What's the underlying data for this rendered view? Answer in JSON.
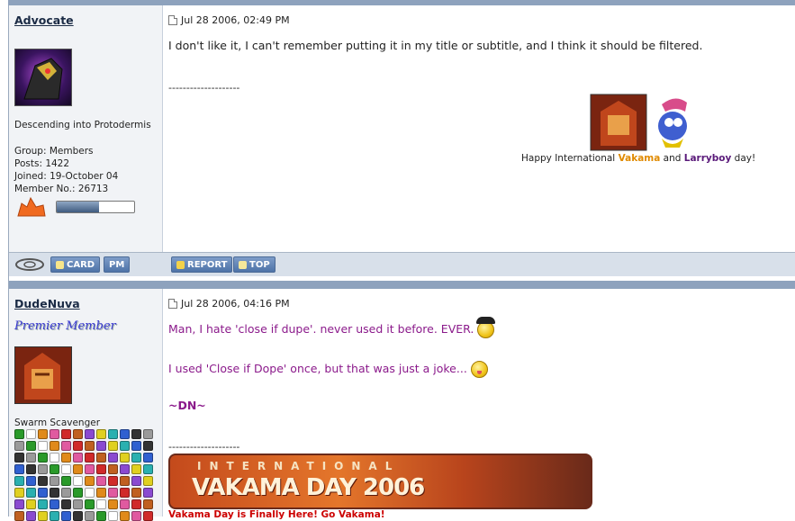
{
  "post1": {
    "author": "Advocate",
    "date": "Jul 28 2006, 02:49 PM",
    "title": "Descending into Protodermis",
    "group": "Group: Members",
    "posts": "Posts: 1422",
    "joined": "Joined: 19-October 04",
    "member_no": "Member No.: 26713",
    "rank_fill": 0.55,
    "message": "I don't like it, I can't remember putting it in my title or subtitle, and I think it should be filtered.",
    "sig_sep": "--------------------",
    "sig_text_pre": "Happy International ",
    "sig_vakama": "Vakama",
    "sig_and": " and ",
    "sig_larryboy": "Larryboy",
    "sig_post": " day!",
    "buttons": {
      "card": "CARD",
      "pm": "PM",
      "report": "REPORT",
      "top": "TOP"
    }
  },
  "post2": {
    "author": "DudeNuva",
    "date": "Jul 28 2006, 04:16 PM",
    "rank_title": "Premier Member",
    "title": "Swarm Scavenger",
    "line1": "Man, I hate 'close if dupe'. never used it before. EVER.",
    "line2": "I used 'Close if Dope' once, but that was just a joke...",
    "line3": "~DN~",
    "sig_sep": "--------------------",
    "banner_top": "INTERNATIONAL",
    "banner_main": "VAKAMA DAY 2006",
    "banner_caption": "Vakama Day is Finally Here! Go Vakama!"
  },
  "colors": {
    "accent": "#8ea2bd",
    "purple": "#8b1a8b",
    "vakama": "#e08a00",
    "larryboy": "#5a1a7a",
    "red": "#cc0000"
  }
}
